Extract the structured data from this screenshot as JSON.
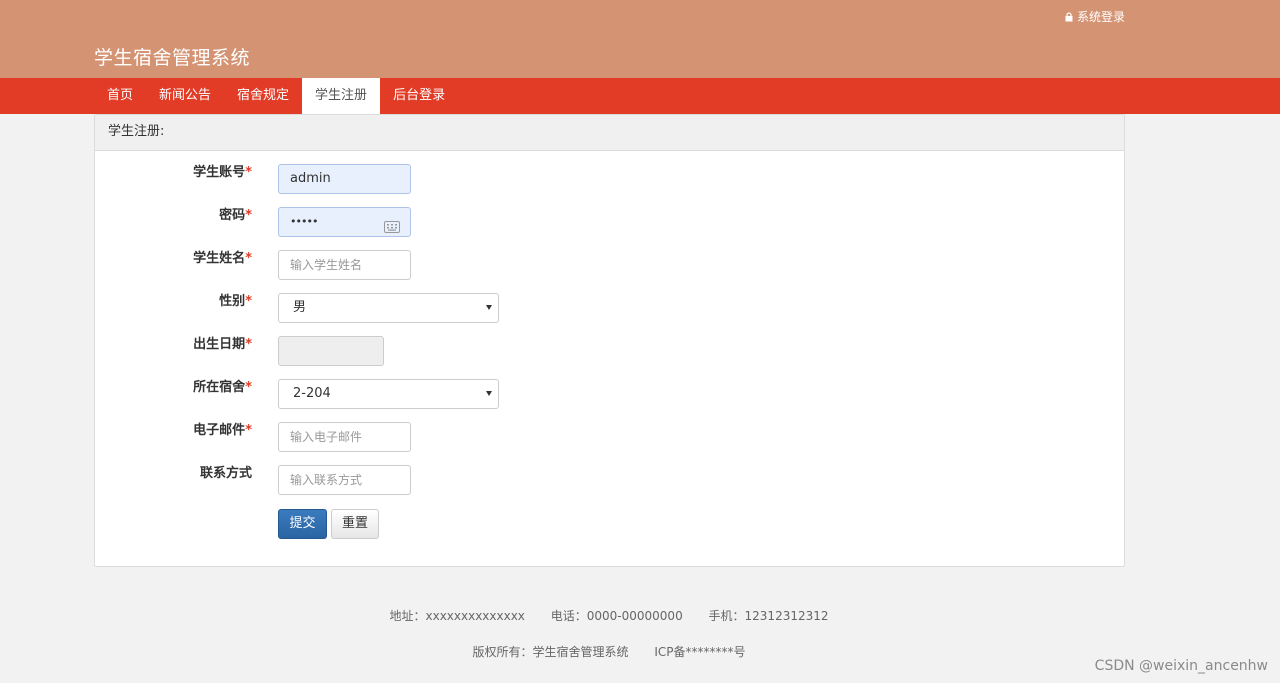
{
  "header": {
    "login_link": "系统登录",
    "lock_icon": "lock-icon",
    "site_title": "学生宿舍管理系统"
  },
  "nav": {
    "items": [
      {
        "label": "首页"
      },
      {
        "label": "新闻公告"
      },
      {
        "label": "宿舍规定"
      },
      {
        "label": "学生注册",
        "active": true
      },
      {
        "label": "后台登录"
      }
    ]
  },
  "panel": {
    "title": "学生注册:"
  },
  "form": {
    "account": {
      "label": "学生账号",
      "required": "*",
      "value": "admin"
    },
    "password": {
      "label": "密码",
      "required": "*",
      "value": "•••••",
      "icon": "keyboard-icon"
    },
    "name": {
      "label": "学生姓名",
      "required": "*",
      "placeholder": "输入学生姓名"
    },
    "gender": {
      "label": "性别",
      "required": "*",
      "value": "男"
    },
    "birthdate": {
      "label": "出生日期",
      "required": "*",
      "value": ""
    },
    "dorm": {
      "label": "所在宿舍",
      "required": "*",
      "value": "2-204"
    },
    "email": {
      "label": "电子邮件",
      "required": "*",
      "placeholder": "输入电子邮件"
    },
    "contact": {
      "label": "联系方式",
      "placeholder": "输入联系方式"
    },
    "submit_label": "提交",
    "reset_label": "重置"
  },
  "footer": {
    "address": "地址：xxxxxxxxxxxxxx",
    "phone": "电话：0000-00000000",
    "mobile": "手机：12312312312",
    "copyright": "版权所有：学生宿舍管理系统",
    "icp": "ICP备********号"
  },
  "watermark": "CSDN @weixin_ancenhw",
  "colors": {
    "header_bg": "#d49373",
    "nav_bg": "#e23b26",
    "primary_button": "#2a64a3",
    "required_mark": "#e23b26"
  }
}
